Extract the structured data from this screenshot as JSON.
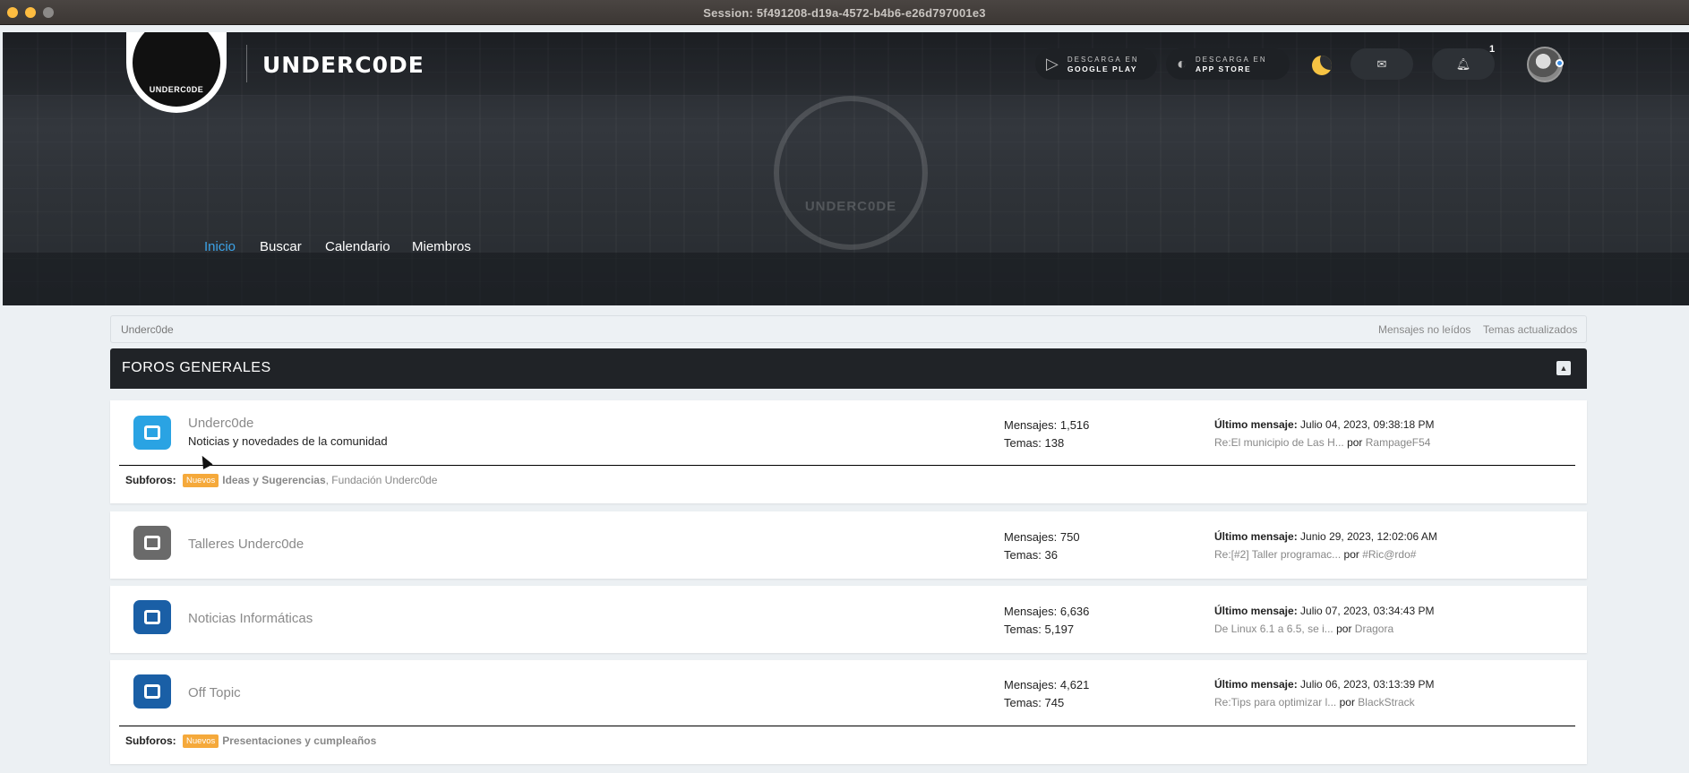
{
  "window": {
    "title": "Session: 5f491208-d19a-4572-b4b6-e26d797001e3"
  },
  "header": {
    "logo_text": "UNDERC0DE",
    "brand": "UNDERC0DE",
    "watermark_text": "UNDERC0DE",
    "google_play": {
      "line1": "DESCARGA EN",
      "line2": "GOOGLE PLAY"
    },
    "app_store": {
      "line1": "DESCARGA EN",
      "line2": "APP STORE"
    },
    "notifications_count": "1",
    "icons": {
      "play": "play-icon",
      "apple": "apple-icon",
      "moon": "moon-icon",
      "mail": "mail-icon",
      "bell": "bell-icon"
    }
  },
  "nav": {
    "items": [
      {
        "label": "Inicio",
        "active": true
      },
      {
        "label": "Buscar"
      },
      {
        "label": "Calendario"
      },
      {
        "label": "Miembros"
      }
    ],
    "active_color": "#3ca3e8"
  },
  "breadcrumb": {
    "current": "Underc0de",
    "unread": "Mensajes no leídos",
    "updated": "Temas actualizados"
  },
  "category": {
    "title": "FOROS GENERALES"
  },
  "boards": [
    {
      "name": "Underc0de",
      "description": "Noticias y novedades de la comunidad",
      "posts": "Mensajes: 1,516",
      "topics": "Temas: 138",
      "last_label": "Último mensaje:",
      "last_date": "Julio 04, 2023, 09:38:18 PM",
      "last_subject": "Re:El municipio de Las H...",
      "por": "por",
      "last_author": "RampageF54",
      "subforos_label": "Subforos:",
      "badge": "Nuevos",
      "subforo_new": "Ideas y Sugerencias",
      "subforo_rest": ", Fundación Underc0de",
      "icon_color": "#2aa3e3"
    },
    {
      "name": "Talleres Underc0de",
      "posts": "Mensajes: 750",
      "topics": "Temas: 36",
      "last_label": "Último mensaje:",
      "last_date": "Junio 29, 2023, 12:02:06 AM",
      "last_subject": "Re:[#2] Taller programac...",
      "por": "por",
      "last_author": "#Ric@rdo#",
      "icon_color": "#6a6a6a"
    },
    {
      "name": "Noticias Informáticas",
      "posts": "Mensajes: 6,636",
      "topics": "Temas: 5,197",
      "last_label": "Último mensaje:",
      "last_date": "Julio 07, 2023, 03:34:43 PM",
      "last_subject": "De Linux 6.1 a 6.5, se i...",
      "por": "por",
      "last_author": "Dragora",
      "icon_color": "#1a5fa6"
    },
    {
      "name": "Off Topic",
      "posts": "Mensajes: 4,621",
      "topics": "Temas: 745",
      "last_label": "Último mensaje:",
      "last_date": "Julio 06, 2023, 03:13:39 PM",
      "last_subject": "Re:Tips para optimizar l...",
      "por": "por",
      "last_author": "BlackStrack",
      "subforos_label": "Subforos:",
      "badge": "Nuevos",
      "subforo_new": "Presentaciones y cumpleaños",
      "icon_color": "#1a5fa6"
    }
  ]
}
